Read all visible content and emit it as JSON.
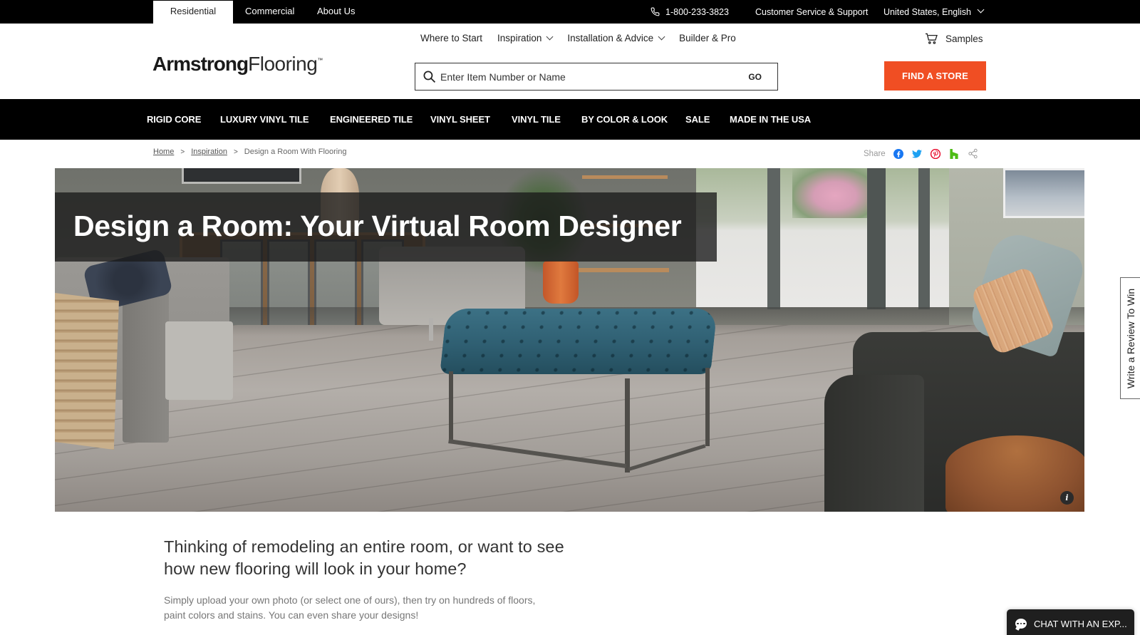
{
  "utility_bar": {
    "tabs": [
      {
        "label": "Residential",
        "active": true
      },
      {
        "label": "Commercial",
        "active": false
      },
      {
        "label": "About Us",
        "active": false
      }
    ],
    "phone": "1-800-233-3823",
    "support_link": "Customer Service & Support",
    "locale": "United States, English"
  },
  "header": {
    "logo_bold": "Armstrong",
    "logo_light": "Flooring",
    "logo_tm": "™",
    "nav_secondary": [
      {
        "label": "Where to Start",
        "has_dropdown": false
      },
      {
        "label": "Inspiration",
        "has_dropdown": true
      },
      {
        "label": "Installation & Advice",
        "has_dropdown": true
      },
      {
        "label": "Builder & Pro",
        "has_dropdown": false
      }
    ],
    "samples_label": "Samples",
    "search": {
      "placeholder": "Enter Item Number or Name",
      "value": "",
      "go_label": "GO"
    },
    "find_store_label": "FIND A STORE"
  },
  "nav_primary": [
    "RIGID CORE",
    "LUXURY VINYL TILE",
    "ENGINEERED TILE",
    "VINYL SHEET",
    "VINYL TILE",
    "BY COLOR & LOOK",
    "SALE",
    "MADE IN THE USA"
  ],
  "breadcrumb": {
    "items": [
      {
        "label": "Home",
        "link": true
      },
      {
        "label": "Inspiration",
        "link": true
      },
      {
        "label": "Design a Room With Flooring",
        "link": false
      }
    ],
    "separator": ">"
  },
  "share": {
    "label": "Share",
    "icons": [
      "facebook-icon",
      "twitter-icon",
      "pinterest-icon",
      "houzz-icon",
      "share-icon"
    ],
    "colors": {
      "facebook": "#1877f2",
      "twitter": "#1da1f2",
      "pinterest": "#e60023",
      "houzz": "#4dbc15",
      "share": "#999999"
    }
  },
  "hero": {
    "title": "Design a Room: Your Virtual Room Designer",
    "info_label": "i"
  },
  "intro": {
    "heading": "Thinking of remodeling an entire room, or want to see how new flooring will look in your home?",
    "body": "Simply upload your own photo (or select one of ours), then try on hundreds of floors, paint colors and stains. You can even share your designs!"
  },
  "review_tab_label": "Write a Review To Win",
  "chat_label": "CHAT WITH AN EXP...",
  "colors": {
    "accent": "#f04e23",
    "nav_bg": "#000000",
    "chat_bg": "#1f1f1f"
  }
}
